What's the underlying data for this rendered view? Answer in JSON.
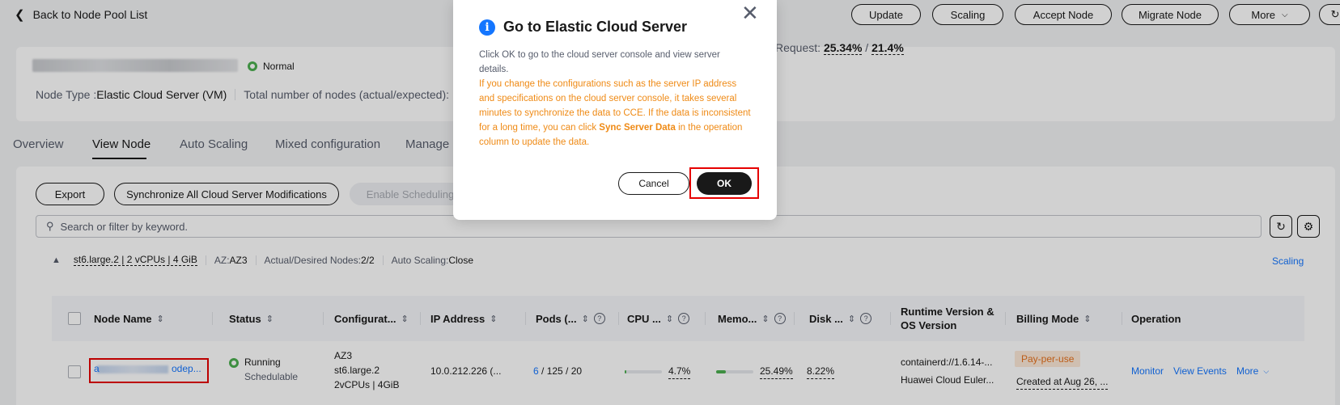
{
  "topbar": {
    "back_label": "Back to Node Pool List",
    "buttons": [
      "Update",
      "Scaling",
      "Accept Node",
      "Migrate Node",
      "More"
    ]
  },
  "summary": {
    "status": "Normal",
    "node_type_label": "Node Type : ",
    "node_type_value": "Elastic Cloud Server (VM)",
    "total_nodes_label": "Total number of nodes (actual/expected):",
    "request_label": "Request: ",
    "request_cpu": "25.34%",
    "request_sep": " / ",
    "request_mem": "21.4%"
  },
  "tabs": [
    "Overview",
    "View Node",
    "Auto Scaling",
    "Mixed configuration",
    "Manage"
  ],
  "toolbar": {
    "export": "Export",
    "sync_all": "Synchronize All Cloud Server Modifications",
    "enable_scheduling": "Enable Scheduling"
  },
  "search": {
    "placeholder": "Search or filter by keyword."
  },
  "pool": {
    "spec": "st6.large.2 | 2 vCPUs | 4 GiB",
    "az_label": "AZ: ",
    "az_value": "AZ3",
    "nodes_label": "Actual/Desired Nodes: ",
    "nodes_value": "2/2",
    "autoscaling_label": "Auto Scaling: ",
    "autoscaling_value": "Close",
    "scaling_link": "Scaling"
  },
  "table": {
    "headers": {
      "node_name": "Node Name",
      "status": "Status",
      "config": "Configurat...",
      "ip": "IP Address",
      "pods": "Pods (...",
      "cpu": "CPU ...",
      "memory": "Memo...",
      "disk": "Disk ...",
      "runtime_line1": "Runtime Version &",
      "runtime_line2": "OS Version",
      "billing": "Billing Mode",
      "operation": "Operation"
    },
    "rows": [
      {
        "name_prefix": "a",
        "name_suffix": "odep...",
        "status": "Running",
        "substatus": "Schedulable",
        "az": "AZ3",
        "flavor": "st6.large.2",
        "resources": "2vCPUs | 4GiB",
        "ip": "10.0.212.226 (...",
        "pods_used": "6",
        "pods_rest": " / 125 / 20",
        "cpu": "4.7%",
        "cpu_fraction": 0.047,
        "memory": "25.49%",
        "memory_fraction": 0.2549,
        "disk": "8.22%",
        "runtime": "containerd://1.6.14-...",
        "os": "Huawei Cloud Euler...",
        "billing": "Pay-per-use",
        "created": "Created at Aug 26, ...",
        "op_monitor": "Monitor",
        "op_events": "View Events",
        "op_more": "More"
      }
    ]
  },
  "dialog": {
    "title": "Go to Elastic Cloud Server",
    "description": "Click OK to go to the cloud server console and view server details.",
    "warning_before": "If you change the configurations such as the server IP address and specifications on the cloud server console, it takes several minutes to synchronize the data to CCE. If the data is inconsistent for a long time, you can click ",
    "warning_bold": "Sync Server Data",
    "warning_after": " in the operation column to update the data.",
    "cancel": "Cancel",
    "ok": "OK"
  },
  "colors": {
    "accent_blue": "#1476ff",
    "success_green": "#4caf50",
    "warning_orange": "#ef8a15",
    "highlight_red": "#e60000"
  }
}
